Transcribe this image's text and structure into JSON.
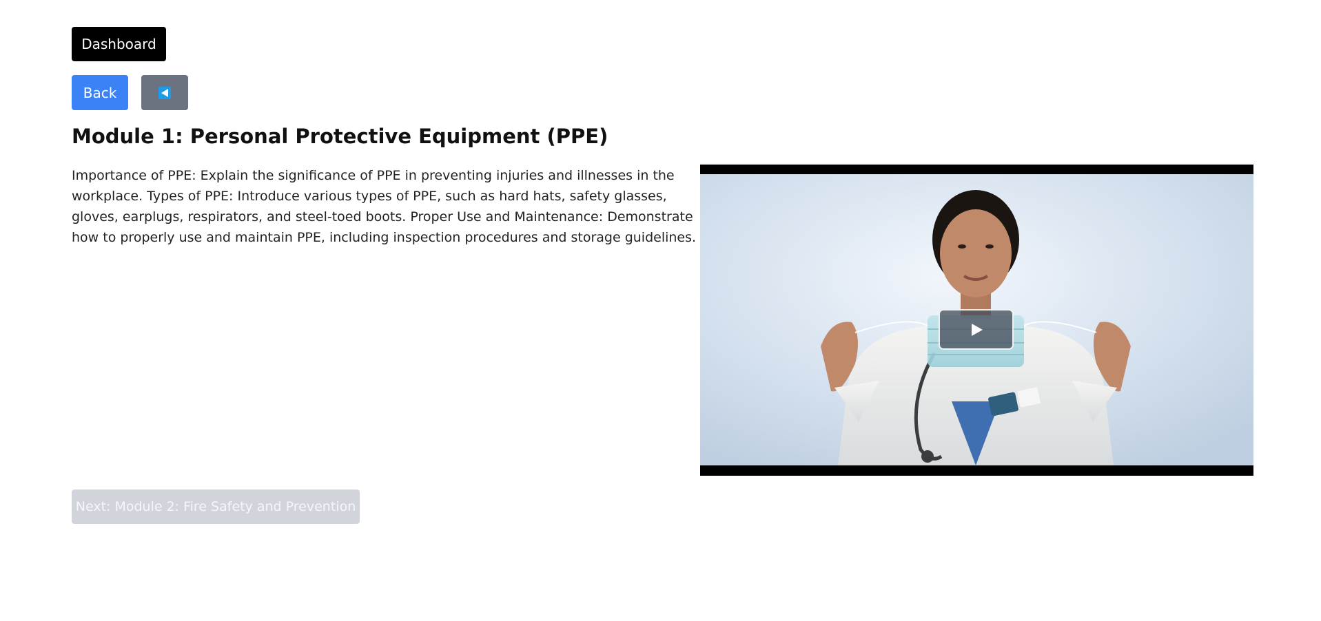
{
  "nav": {
    "dashboard_label": "Dashboard",
    "back_label": "Back"
  },
  "module": {
    "title": "Module 1: Personal Protective Equipment (PPE)",
    "description": "Importance of PPE: Explain the significance of PPE in preventing injuries and illnesses in the workplace. Types of PPE: Introduce various types of PPE, such as hard hats, safety glasses, gloves, earplugs, respirators, and steel-toed boots. Proper Use and Maintenance: Demonstrate how to properly use and maintain PPE, including inspection procedures and storage guidelines."
  },
  "video": {
    "subject": "doctor holding face mask",
    "play_icon": "play-icon"
  },
  "footer": {
    "next_label": "Next: Module 2: Fire Safety and Prevention",
    "next_disabled": true
  },
  "colors": {
    "dashboard_bg": "#000000",
    "back_bg": "#3b82f6",
    "audio_bg": "#6b7280",
    "audio_glyph": "#1e9be8",
    "next_disabled_bg": "#d1d5db"
  },
  "icons": {
    "audio": "speaker-icon"
  }
}
